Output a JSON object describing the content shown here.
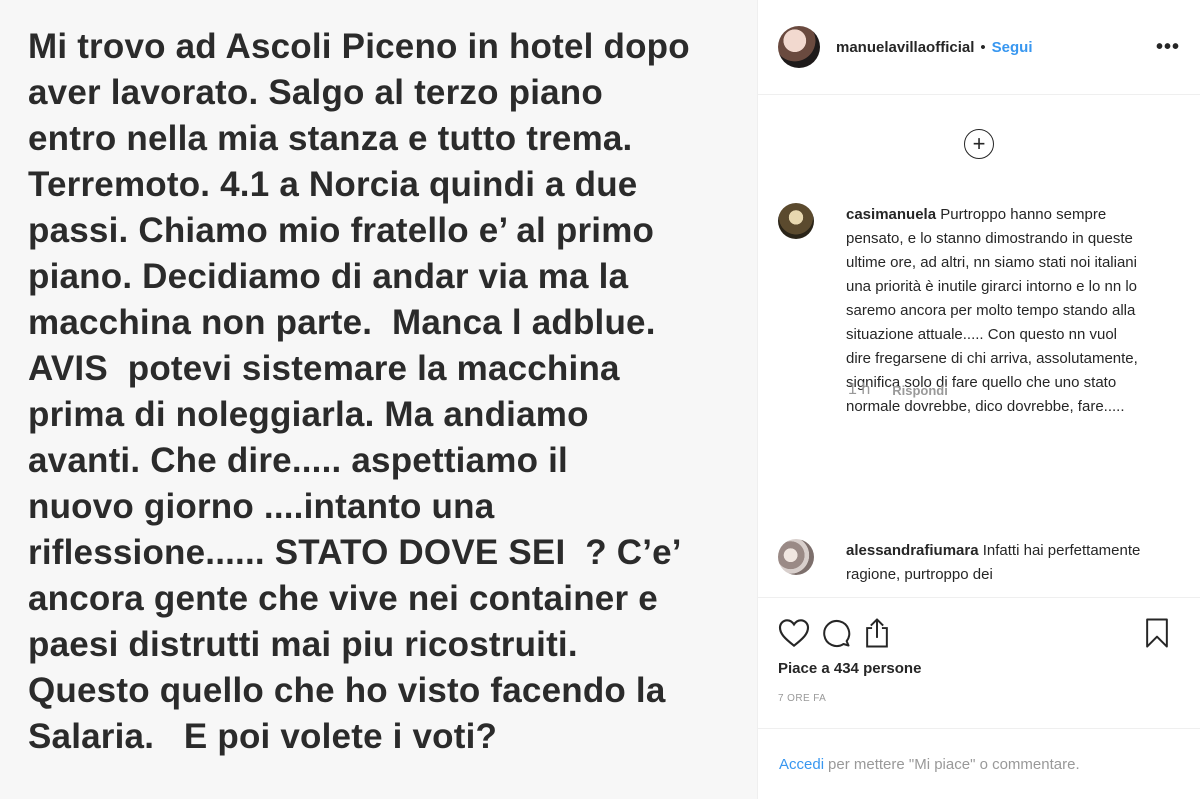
{
  "post": {
    "text": "Mi trovo ad Ascoli Piceno in hotel dopo\naver lavorato. Salgo al terzo piano\nentro nella mia stanza e tutto trema.\nTerremoto. 4.1 a Norcia quindi a due\npassi. Chiamo mio fratello e’ al primo\npiano. Decidiamo di andar via ma la\nmacchina non parte.  Manca l adblue.\nAVIS  potevi sistemare la macchina\nprima di noleggiarla. Ma andiamo\navanti. Che dire..... aspettiamo il\nnuovo giorno ....intanto una\nriflessione...... STATO DOVE SEI  ? C’e’\nancora gente che vive nei container e\npaesi distrutti mai piu ricostruiti.\nQuesto quello che ho visto facendo la\nSalaria.   E poi volete i voti?"
  },
  "header": {
    "username": "manuelavillaofficial",
    "separator": "•",
    "follow_label": "Segui",
    "more_label": "•••"
  },
  "load_more_icon": "plus-circle-icon",
  "comments": [
    {
      "user": "casimanuela",
      "text": "Purtroppo hanno sempre pensato, e lo stanno dimostrando in queste ultime ore, ad altri, nn siamo stati noi italiani una priorità è inutile girarci intorno e lo nn lo saremo ancora per molto tempo stando alla situazione attuale..... Con questo nn vuol dire fregarsene di chi arriva, assolutamente, significa solo di fare quello che uno stato normale dovrebbe, dico dovrebbe, fare.....",
      "time": "1 h",
      "reply_label": "Rispondi"
    },
    {
      "user": "alessandrafiumara",
      "text": "Infatti hai perfettamente ragione, purtroppo dei"
    }
  ],
  "actions": {
    "icons": [
      "heart-icon",
      "comment-icon",
      "share-icon",
      "bookmark-icon"
    ],
    "likes": "Piace a 434 persone",
    "timestamp": "7 ORE FA"
  },
  "footer": {
    "login_link": "Accedi",
    "login_text": "per mettere \"Mi piace\" o commentare."
  },
  "colors": {
    "link_blue": "#3897f0",
    "muted_gray": "#999999",
    "text_dark": "#262626"
  }
}
